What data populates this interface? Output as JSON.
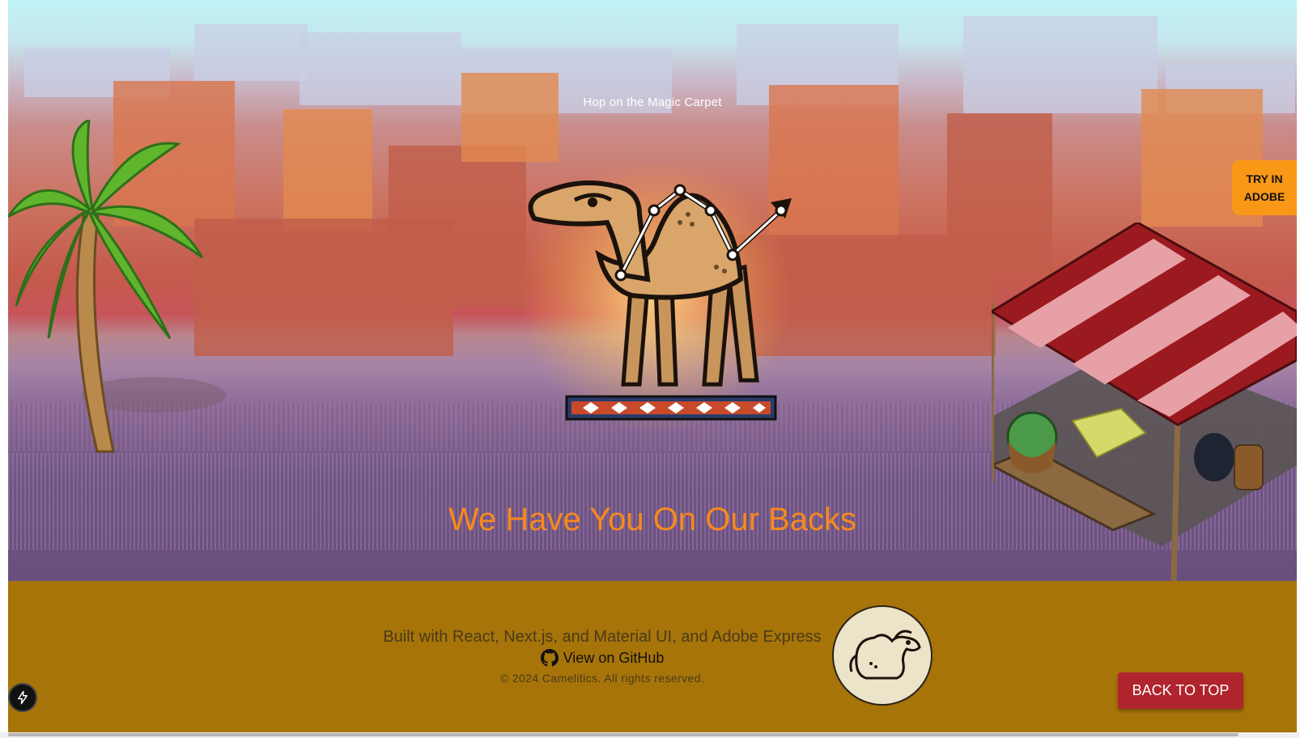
{
  "hero": {
    "subtitle": "Hop on the Magic Carpet",
    "title": "We Have You On Our Backs",
    "try_button": "TRY IN ADOBE"
  },
  "footer": {
    "built_with": "Built with React, Next.js, and Material UI, and Adobe Express",
    "github_link": "View on GitHub",
    "copyright": "© 2024 Camelitics. All rights reserved.",
    "back_to_top": "BACK TO TOP"
  },
  "icons": {
    "github": "github-icon",
    "bolt": "bolt-icon",
    "logo": "camel-logo",
    "hero_camel": "camel-on-carpet-illustration",
    "palm": "palm-tree-illustration",
    "stall": "market-stall-illustration"
  },
  "colors": {
    "title": "#f7891d",
    "try_button": "#f99717",
    "footer_bg": "#a7740a",
    "back_to_top": "#b0242d"
  }
}
